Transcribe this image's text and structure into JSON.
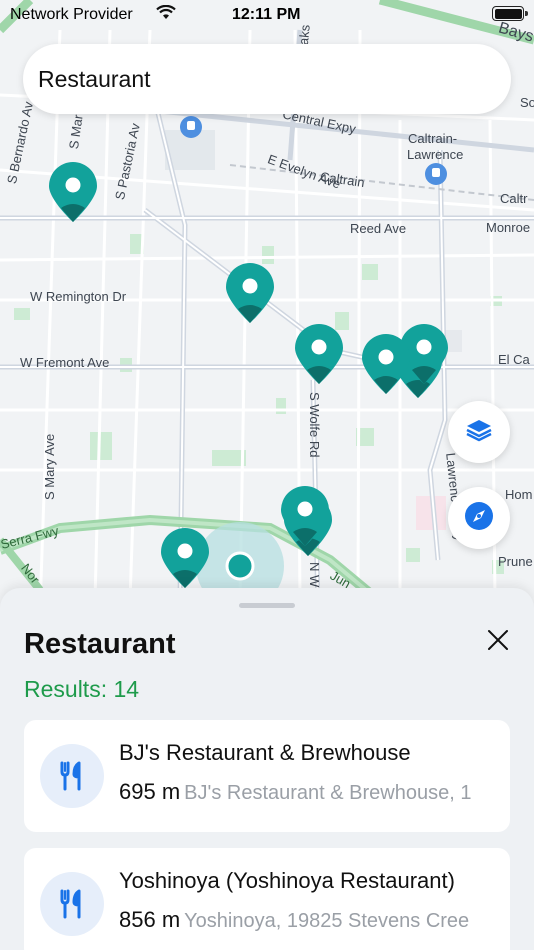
{
  "status_bar": {
    "carrier": "Network Provider",
    "time": "12:11 PM"
  },
  "search": {
    "value": "Restaurant"
  },
  "map": {
    "labels": {
      "bays": "Bays",
      "so": "So",
      "bernardo": "S Bernardo Av",
      "mar": "S Mar",
      "pastoria": "S Pastoria Av",
      "fair_oaks": "Fair Oaks",
      "central_expy": "Central Expy",
      "caltrain_lawrence_1": "Caltrain-",
      "caltrain_lawrence_2": "Lawrence",
      "caltrain": "Caltrain",
      "caltr": "Caltr",
      "evelyn": "E Evelyn Ave",
      "reed": "Reed Ave",
      "monroe": "Monroe",
      "remington": "W Remington Dr",
      "fremont": "W Fremont Ave",
      "el_ca": "El Ca",
      "wolfe": "S Wolfe Rd",
      "mary": "S Mary Ave",
      "lawrence_expy": "Lawrence Expy",
      "homestead": "Hom",
      "serra_fwy": "Serra Fwy",
      "jun": "Jun",
      "prune": "Prune",
      "nor": "Nor",
      "n_w": "N W"
    },
    "layers_icon": "layers-icon",
    "compass_icon": "compass-icon"
  },
  "sheet": {
    "title": "Restaurant",
    "results_count": "Results: 14",
    "results": [
      {
        "name": "BJ's Restaurant & Brewhouse",
        "distance": "695 m",
        "address": "BJ's Restaurant & Brewhouse, 1",
        "icon": "fork-knife-icon"
      },
      {
        "name": "Yoshinoya (Yoshinoya Restaurant)",
        "distance": "856 m",
        "address": "Yoshinoya, 19825 Stevens Cree",
        "icon": "fork-knife-icon"
      }
    ]
  },
  "colors": {
    "pin": "#12a29b",
    "accent_blue": "#1a73e8",
    "results_green": "#1e9b4b"
  }
}
